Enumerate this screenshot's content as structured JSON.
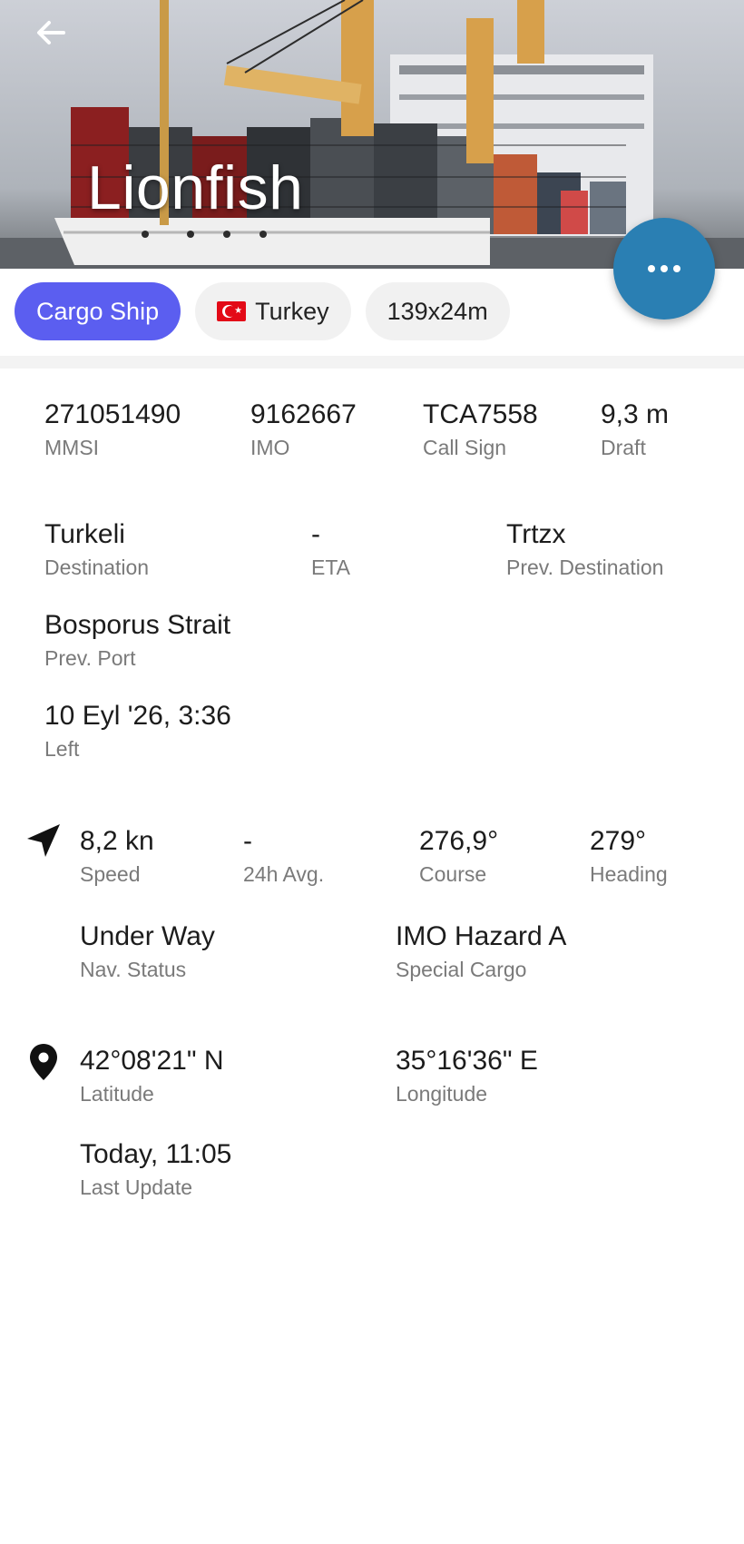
{
  "header": {
    "title": "Lionfish"
  },
  "chips": {
    "type": "Cargo Ship",
    "country": "Turkey",
    "dimensions": "139x24m"
  },
  "identity": {
    "mmsi": {
      "value": "271051490",
      "label": "MMSI"
    },
    "imo": {
      "value": "9162667",
      "label": "IMO"
    },
    "call_sign": {
      "value": "TCA7558",
      "label": "Call Sign"
    },
    "draft": {
      "value": "9,3 m",
      "label": "Draft"
    }
  },
  "voyage": {
    "destination": {
      "value": "Turkeli",
      "label": "Destination"
    },
    "eta": {
      "value": "-",
      "label": "ETA"
    },
    "prev_destination": {
      "value": "Trtzx",
      "label": "Prev. Destination"
    },
    "prev_port": {
      "value": "Bosporus Strait",
      "label": "Prev. Port"
    },
    "left": {
      "value": "10 Eyl '26, 3:36",
      "label": "Left"
    }
  },
  "navigation": {
    "icon": "navigation-arrow-icon",
    "speed": {
      "value": "8,2 kn",
      "label": "Speed"
    },
    "avg": {
      "value": "-",
      "label": "24h Avg."
    },
    "course": {
      "value": "276,9°",
      "label": "Course"
    },
    "heading": {
      "value": "279°",
      "label": "Heading"
    },
    "nav_status": {
      "value": "Under Way",
      "label": "Nav. Status"
    },
    "special_cargo": {
      "value": "IMO Hazard A",
      "label": "Special Cargo"
    }
  },
  "position": {
    "icon": "location-pin-icon",
    "latitude": {
      "value": "42°08'21\" N",
      "label": "Latitude"
    },
    "longitude": {
      "value": "35°16'36\" E",
      "label": "Longitude"
    },
    "last_update": {
      "value": "Today, 11:05",
      "label": "Last Update"
    }
  },
  "colors": {
    "accent_chip": "#5b5ef0",
    "fab": "#2a7fb3",
    "flag_red": "#e30a17"
  }
}
